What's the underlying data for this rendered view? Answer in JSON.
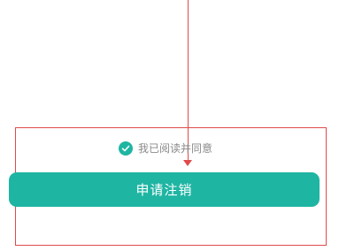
{
  "agreement": {
    "label": "我已阅读并同意",
    "checked": true,
    "check_icon": "check-circle-icon"
  },
  "primary_action": {
    "label": "申请注销"
  },
  "colors": {
    "accent": "#1fb5a3",
    "annotation": "#e04a4a",
    "muted_text": "#8a8a8a"
  }
}
